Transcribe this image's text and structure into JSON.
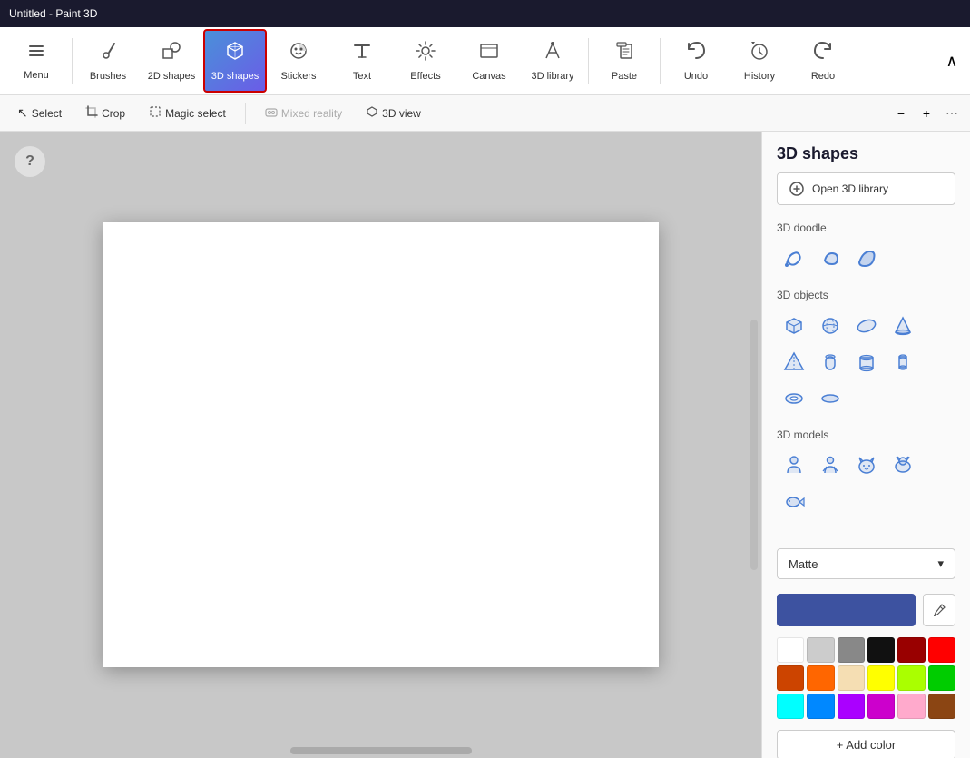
{
  "titlebar": {
    "title": "Untitled - Paint 3D"
  },
  "toolbar": {
    "menu_label": "Menu",
    "brushes_label": "Brushes",
    "shapes_2d_label": "2D shapes",
    "shapes_3d_label": "3D shapes",
    "stickers_label": "Stickers",
    "text_label": "Text",
    "effects_label": "Effects",
    "canvas_label": "Canvas",
    "library_label": "3D library",
    "paste_label": "Paste",
    "undo_label": "Undo",
    "history_label": "History",
    "redo_label": "Redo"
  },
  "secondary_toolbar": {
    "select_label": "Select",
    "crop_label": "Crop",
    "magic_select_label": "Magic select",
    "mixed_reality_label": "Mixed reality",
    "view_3d_label": "3D view"
  },
  "right_panel": {
    "title": "3D shapes",
    "open_library_label": "Open 3D library",
    "doodle_section": "3D doodle",
    "objects_section": "3D objects",
    "models_section": "3D models",
    "material_label": "Matte",
    "add_color_label": "+ Add color"
  },
  "colors": {
    "selected": "#3d52a0",
    "palette": [
      "#ffffff",
      "#cccccc",
      "#888888",
      "#111111",
      "#990000",
      "#ff0000",
      "#cc4400",
      "#ff6600",
      "#f5deb3",
      "#ffff00",
      "#aaff00",
      "#00cc00",
      "#00ffff",
      "#0088ff",
      "#aa00ff",
      "#cc00cc",
      "#ffaacc",
      "#8b4513"
    ]
  }
}
